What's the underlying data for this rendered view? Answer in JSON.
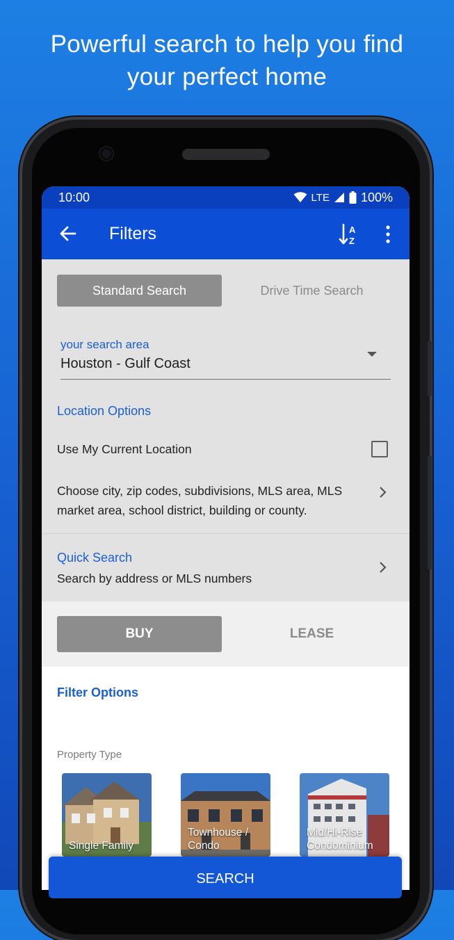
{
  "headline": [
    "Powerful search to help you find",
    "your perfect home"
  ],
  "status_bar": {
    "time": "10:00",
    "network": "LTE",
    "battery": "100%"
  },
  "app_bar": {
    "title": "Filters",
    "icons": [
      "back-arrow-icon",
      "sort-az-icon",
      "more-vert-icon"
    ]
  },
  "search_mode": {
    "options": [
      "Standard Search",
      "Drive Time Search"
    ],
    "selected": "Standard Search"
  },
  "search_area": {
    "label": "your search area",
    "value": "Houston - Gulf Coast"
  },
  "location_options": {
    "title": "Location Options",
    "use_current_location": {
      "label": "Use My Current Location",
      "checked": false
    },
    "choose_label": "Choose city, zip codes, subdivisions, MLS area, MLS market area, school district, building or county."
  },
  "quick_search": {
    "title": "Quick Search",
    "subtitle": "Search by address or MLS numbers"
  },
  "transaction": {
    "options": [
      "BUY",
      "LEASE"
    ],
    "selected": "BUY"
  },
  "filter_options": {
    "title": "Filter Options",
    "property_type_label": "Property Type",
    "property_types": [
      {
        "line1": "Single Family",
        "line2": ""
      },
      {
        "line1": "Townhouse /",
        "line2": "Condo"
      },
      {
        "line1": "Mid/Hi-Rise",
        "line2": "Condominium"
      }
    ]
  },
  "search_button": "SEARCH",
  "colors": {
    "background": "#1d7fe3",
    "app_bar": "#0c4fd6",
    "status_bar": "#0a3fbd",
    "accent": "#1b5fd0",
    "search_button": "#1356d6"
  }
}
